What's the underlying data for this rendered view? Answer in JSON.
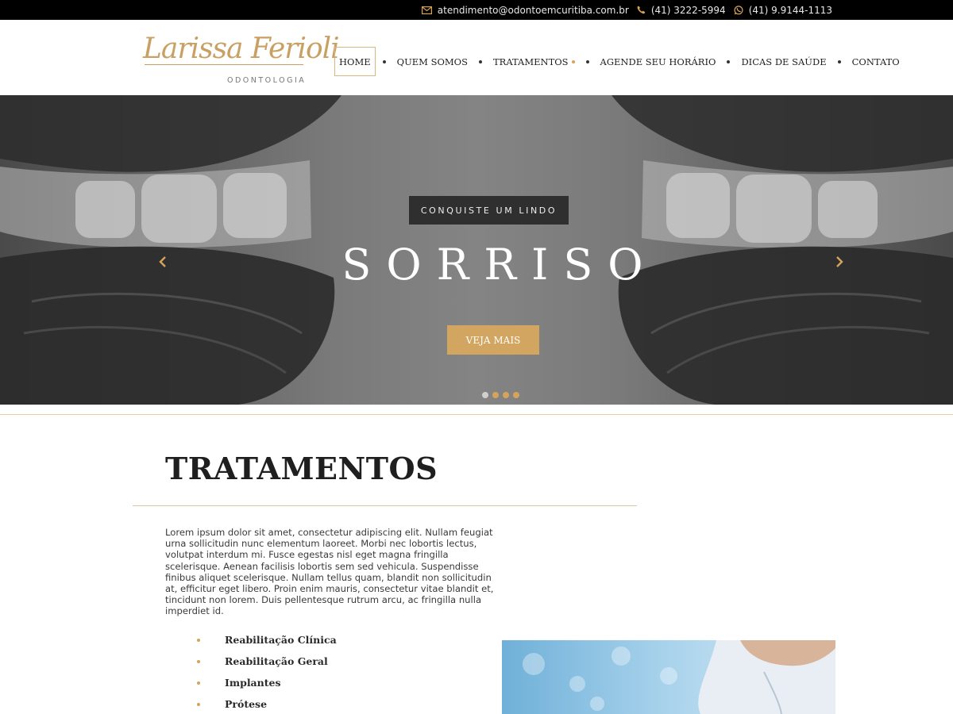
{
  "topbar": {
    "email": "atendimento@odontoemcuritiba.com.br",
    "phone": "(41) 3222-5994",
    "whatsapp": "(41) 9.9144-1113"
  },
  "logo": {
    "script": "Larissa Ferioli",
    "subtitle": "ODONTOLOGIA"
  },
  "nav": {
    "items": [
      {
        "label": "HOME"
      },
      {
        "label": "QUEM SOMOS"
      },
      {
        "label": "TRATAMENTOS"
      },
      {
        "label": "AGENDE SEU HORÁRIO"
      },
      {
        "label": "DICAS DE SAÚDE"
      },
      {
        "label": "CONTATO"
      }
    ]
  },
  "hero": {
    "kicker": "CONQUISTE UM LINDO",
    "headline": "SORRISO",
    "cta": "VEJA MAIS",
    "slides_total": 4,
    "active_slide": 1
  },
  "treatments": {
    "title": "TRATAMENTOS",
    "intro": "Lorem ipsum dolor sit amet, consectetur adipiscing elit. Nullam feugiat urna sollicitudin nunc elementum laoreet. Morbi nec lobortis lectus, volutpat interdum mi. Fusce egestas nisl eget magna fringilla scelerisque. Aenean facilisis lobortis sem sed vehicula. Suspendisse finibus aliquet scelerisque. Nullam tellus quam, blandit non sollicitudin at, efficitur eget libero. Proin enim mauris, consectetur vitae blandit et, tincidunt non lorem. Duis pellentesque rutrum arcu, ac fringilla nulla imperdiet id.",
    "items": [
      "Reabilitação Clínica",
      "Reabilitação Geral",
      "Implantes",
      "Prótese"
    ]
  },
  "colors": {
    "gold": "#d2a560",
    "topbar": "#000000",
    "kicker_bg": "#2f2f2f"
  }
}
